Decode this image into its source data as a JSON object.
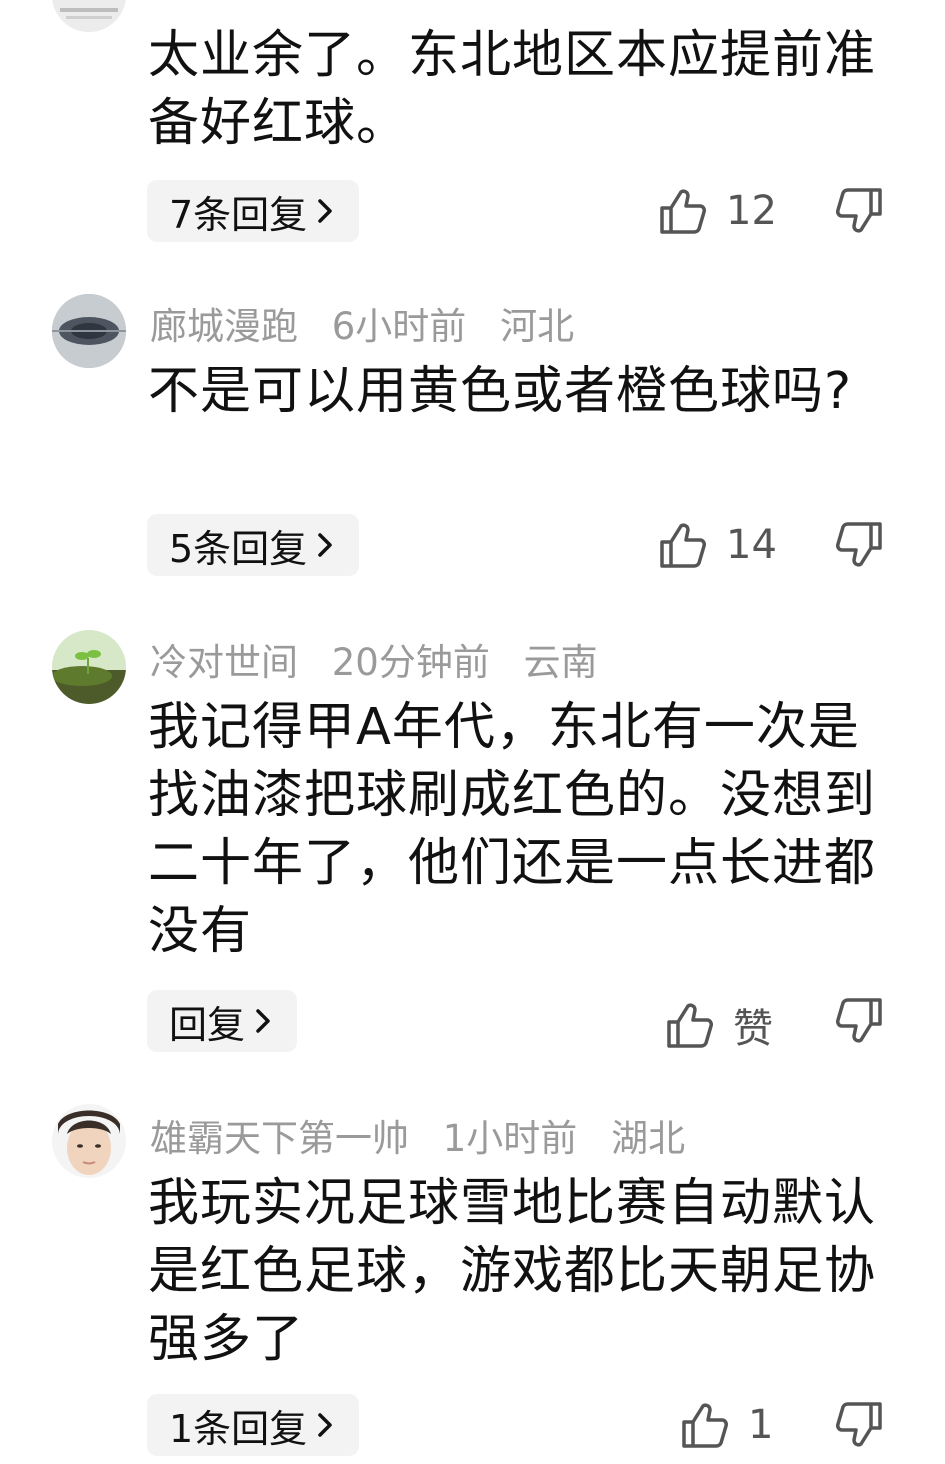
{
  "comments": [
    {
      "username": "",
      "time": "",
      "location": "",
      "content": "太业余了。东北地区本应提前准备好红球。",
      "reply_label": "7条回复",
      "likes": "12",
      "avatar_icon": "avatar-partial"
    },
    {
      "username": "廊城漫跑",
      "time": "6小时前",
      "location": "河北",
      "content": "不是可以用黄色或者橙色球吗?",
      "reply_label": "5条回复",
      "likes": "14",
      "avatar_icon": "avatar-landscape"
    },
    {
      "username": "冷对世间",
      "time": "20分钟前",
      "location": "云南",
      "content": "我记得甲A年代，东北有一次是找油漆把球刷成红色的。没想到二十年了，他们还是一点长进都没有",
      "reply_label": "回复",
      "likes": "赞",
      "avatar_icon": "avatar-sprout"
    },
    {
      "username": "雄霸天下第一帅",
      "time": "1小时前",
      "location": "湖北",
      "content": "我玩实况足球雪地比赛自动默认是红色足球，游戏都比天朝足协强多了",
      "reply_label": "1条回复",
      "likes": "1",
      "avatar_icon": "avatar-face"
    }
  ],
  "colors": {
    "meta_text": "#9a9a9a",
    "reply_bg": "#f3f3f3",
    "icon": "#555555"
  }
}
